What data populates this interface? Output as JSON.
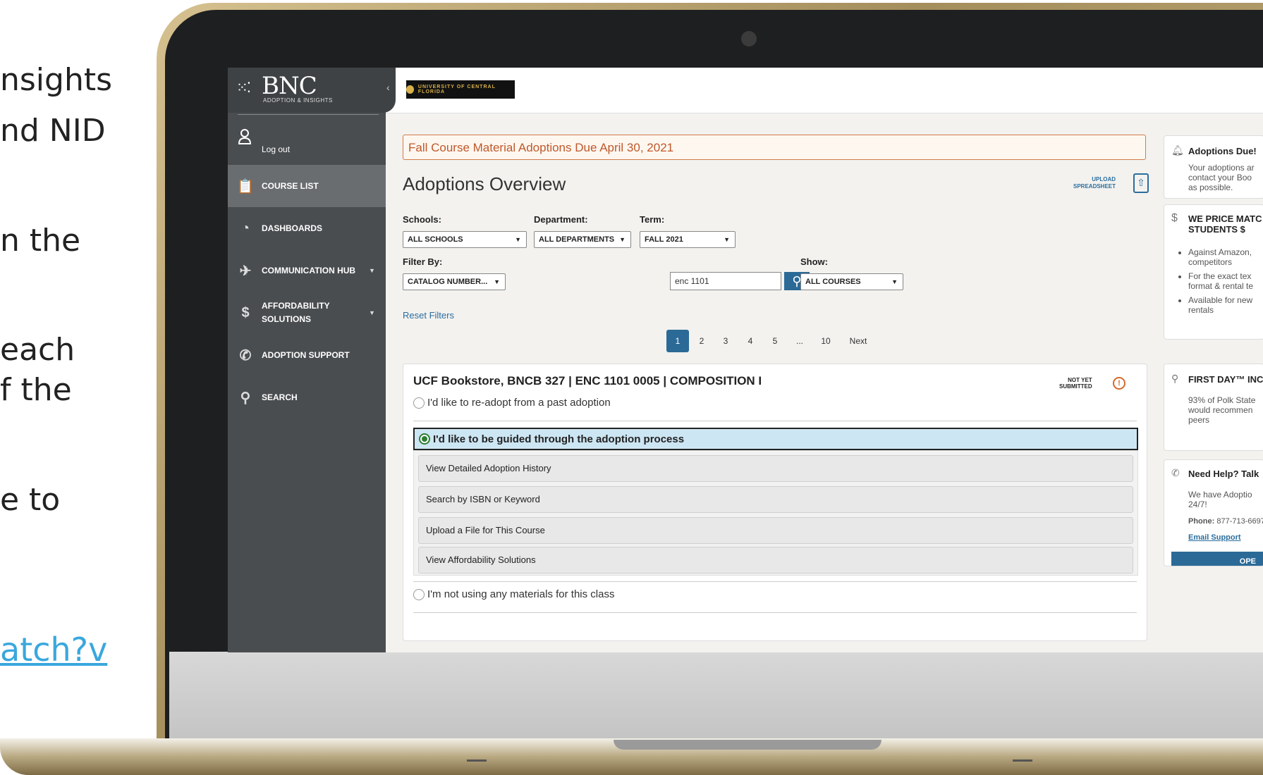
{
  "slide": {
    "lines": [
      "nsights",
      "nd NID",
      "n the",
      "each",
      "f the",
      "e to"
    ],
    "link": "atch?v"
  },
  "sidebar": {
    "logo_text": "BNC",
    "logo_sub": "ADOPTION & INSIGHTS",
    "logout": "Log out",
    "items": [
      {
        "label": "COURSE LIST"
      },
      {
        "label": "DASHBOARDS"
      },
      {
        "label": "COMMUNICATION HUB"
      },
      {
        "label": "AFFORDABILITY SOLUTIONS"
      },
      {
        "label": "ADOPTION SUPPORT"
      },
      {
        "label": "SEARCH"
      }
    ]
  },
  "header": {
    "university_logo": "UNIVERSITY OF CENTRAL FLORIDA"
  },
  "main": {
    "banner": "Fall Course Material Adoptions Due April 30, 2021",
    "title": "Adoptions Overview",
    "upload_line1": "UPLOAD",
    "upload_line2": "SPREADSHEET",
    "filters": {
      "schools_label": "Schools:",
      "schools_value": "ALL SCHOOLS",
      "department_label": "Department:",
      "department_value": "ALL DEPARTMENTS",
      "term_label": "Term:",
      "term_value": "FALL 2021",
      "filter_by_label": "Filter By:",
      "filter_by_value": "CATALOG NUMBER...",
      "search_value": "enc 1101",
      "show_label": "Show:",
      "show_value": "ALL COURSES",
      "reset": "Reset Filters"
    },
    "pagination": [
      "1",
      "2",
      "3",
      "4",
      "5",
      "...",
      "10",
      "Next"
    ],
    "course": {
      "title": "UCF Bookstore, BNCB 327 | ENC 1101 0005 | COMPOSITION I",
      "status_line1": "NOT YET",
      "status_line2": "SUBMITTED",
      "option_readopt": "I'd like to re-adopt from a past adoption",
      "option_guided": "I'd like to be guided through the adoption process",
      "sub_actions": [
        "View Detailed Adoption History",
        "Search by ISBN or Keyword",
        "Upload a File for This Course",
        "View Affordability Solutions"
      ],
      "option_none": "I'm not using any materials for this class"
    }
  },
  "right_panels": {
    "due": {
      "title": "Adoptions Due!",
      "l1": "Your adoptions ar",
      "l2": "contact your Boo",
      "l3": "as possible."
    },
    "price": {
      "title1": "WE PRICE MATC",
      "title2": "STUDENTS $",
      "b1a": "Against Amazon,",
      "b1b": "competitors",
      "b2a": "For the exact tex",
      "b2b": "format & rental te",
      "b3a": "Available for new",
      "b3b": "rentals"
    },
    "firstday": {
      "title": "FIRST DAY™ INC",
      "l1": "93% of Polk State",
      "l2": "would recommen",
      "l3": "peers"
    },
    "help": {
      "title": "Need Help? Talk",
      "l1": "We have Adoptio",
      "l2": "24/7!",
      "phone_label": "Phone:",
      "phone": "877-713-6697",
      "email": "Email Support",
      "open": "OPE"
    }
  }
}
